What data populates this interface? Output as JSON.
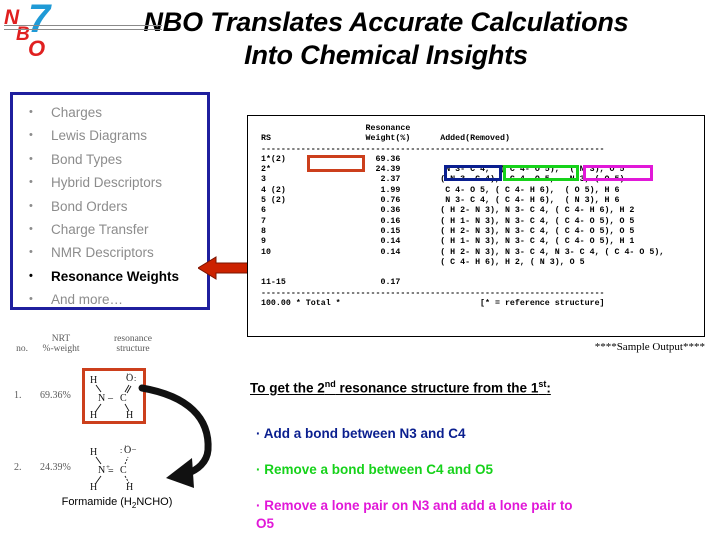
{
  "slide": {
    "title_line1": "NBO Translates Accurate Calculations",
    "title_line2": "Into Chemical Insights",
    "logo_letters": [
      "N",
      "B",
      "O",
      "7"
    ]
  },
  "colors": {
    "panel_border": "#1f1f9e",
    "arrow_red": "#cc2200",
    "highlight_orange": "#cc3f1c",
    "highlight_blue": "#0a1f8f",
    "highlight_green": "#16d21a",
    "highlight_magenta": "#e118d8",
    "dim_text": "#8c8c8c"
  },
  "bullets": {
    "items": [
      {
        "label": "Charges",
        "highlighted": false
      },
      {
        "label": "Lewis Diagrams",
        "highlighted": false
      },
      {
        "label": "Bond Types",
        "highlighted": false
      },
      {
        "label": "Hybrid Descriptors",
        "highlighted": false
      },
      {
        "label": "Bond Orders",
        "highlighted": false
      },
      {
        "label": "Charge Transfer",
        "highlighted": false
      },
      {
        "label": "NMR Descriptors",
        "highlighted": false
      },
      {
        "label": "Resonance Weights",
        "highlighted": true
      },
      {
        "label": "And more…",
        "highlighted": false
      }
    ]
  },
  "output": {
    "caption": "****Sample Output****",
    "header": {
      "col1": "RS",
      "col2_line1": "Resonance",
      "col2_line2": "Weight(%)",
      "col3": "Added(Removed)"
    },
    "text": "                      Resonance\n RS                   Weight(%)      Added(Removed)\n ---------------------------------------------------------------------\n 1*(2)                  69.36\n 2*                     24.39         N 3- C 4,  ( C 4- O 5),  ( N 3), O 5\n 3                       2.37        ( N 3- C 4),  C 4- O 5,   N 3, ( O 5)\n 4 (2)                   1.99         C 4- O 5, ( C 4- H 6),  ( O 5), H 6\n 5 (2)                   0.76         N 3- C 4, ( C 4- H 6),  ( N 3), H 6\n 6                       0.36        ( H 2- N 3), N 3- C 4, ( C 4- H 6), H 2\n 7                       0.16        ( H 1- N 3), N 3- C 4, ( C 4- O 5), O 5\n 8                       0.15        ( H 2- N 3), N 3- C 4, ( C 4- O 5), O 5\n 9                       0.14        ( H 1- N 3), N 3- C 4, ( C 4- O 5), H 1\n 10                      0.14        ( H 2- N 3), N 3- C 4, N 3- C 4, ( C 4- O 5),\n                                     ( C 4- H 6), H 2, ( N 3), O 5\n\n 11-15                   0.17\n ---------------------------------------------------------------------\n 100.00 * Total *                            [* = reference structure]",
    "rows": [
      {
        "rs": "1*(2)",
        "weight": "69.36",
        "added_removed": ""
      },
      {
        "rs": "2*",
        "weight": "24.39",
        "added_removed": "N 3- C 4,  ( C 4- O 5),  ( N 3), O 5"
      },
      {
        "rs": "3",
        "weight": "2.37",
        "added_removed": "( N 3- C 4),  C 4- O 5,  N 3, ( O 5)"
      },
      {
        "rs": "4 (2)",
        "weight": "1.99",
        "added_removed": "C 4- O 5, ( C 4- H 6),  ( O 5), H 6"
      },
      {
        "rs": "5 (2)",
        "weight": "0.76",
        "added_removed": "N 3- C 4, ( C 4- H 6),  ( N 3), H 6"
      },
      {
        "rs": "6",
        "weight": "0.36",
        "added_removed": "( H 2- N 3), N 3- C 4, ( C 4- H 6), H 2"
      },
      {
        "rs": "7",
        "weight": "0.16",
        "added_removed": "( H 1- N 3), N 3- C 4, ( C 4- O 5), O 5"
      },
      {
        "rs": "8",
        "weight": "0.15",
        "added_removed": "( H 2- N 3), N 3- C 4, ( C 4- O 5), O 5"
      },
      {
        "rs": "9",
        "weight": "0.14",
        "added_removed": "( H 1- N 3), N 3- C 4, ( C 4- O 5), H 1"
      },
      {
        "rs": "10",
        "weight": "0.14",
        "added_removed": "( H 2- N 3), N 3- C 4, N 3- C 4, ( C 4- O 5), ( C 4- H 6), H 2, ( N 3), O 5"
      },
      {
        "rs": "11-15",
        "weight": "0.17",
        "added_removed": ""
      }
    ],
    "total_line": "100.00 * Total *",
    "footnote": "[* = reference structure]",
    "highlighted_fragments": {
      "weight_orange": "69.36",
      "blue": "N 3- C 4,",
      "green": "( C 4- O 5),",
      "magenta": "( N 3), O 5"
    }
  },
  "nrt_figure": {
    "header": {
      "no": "no.",
      "nrt": "NRT",
      "weight": "%-weight",
      "resonance": "resonance",
      "structure": "structure"
    },
    "rows": [
      {
        "no": "1.",
        "weight": "69.36%",
        "boxed": true
      },
      {
        "no": "2.",
        "weight": "24.39%",
        "boxed": false
      }
    ],
    "structure1": {
      "atoms": [
        "H",
        "O",
        "N",
        "C",
        "H",
        "H"
      ],
      "bond_nc": "–",
      "o_lone": ":"
    },
    "structure2": {
      "atoms": [
        "H",
        "O",
        "N",
        "C",
        "H",
        "H"
      ],
      "bond_nc": "=",
      "n_charge": "+",
      "o_charge": "−"
    },
    "caption_pre": "Formamide (H",
    "caption_sub": "2",
    "caption_post": "NCHO)"
  },
  "explanation": {
    "heading_pre": "To get the 2",
    "heading_sup1": "nd",
    "heading_mid": " resonance structure from the 1",
    "heading_sup2": "st",
    "heading_post": ":",
    "bullets": [
      "· Add a bond between N3 and C4",
      "· Remove a bond between C4 and O5",
      "· Remove a lone pair on N3 and add a lone pair to O5"
    ]
  }
}
